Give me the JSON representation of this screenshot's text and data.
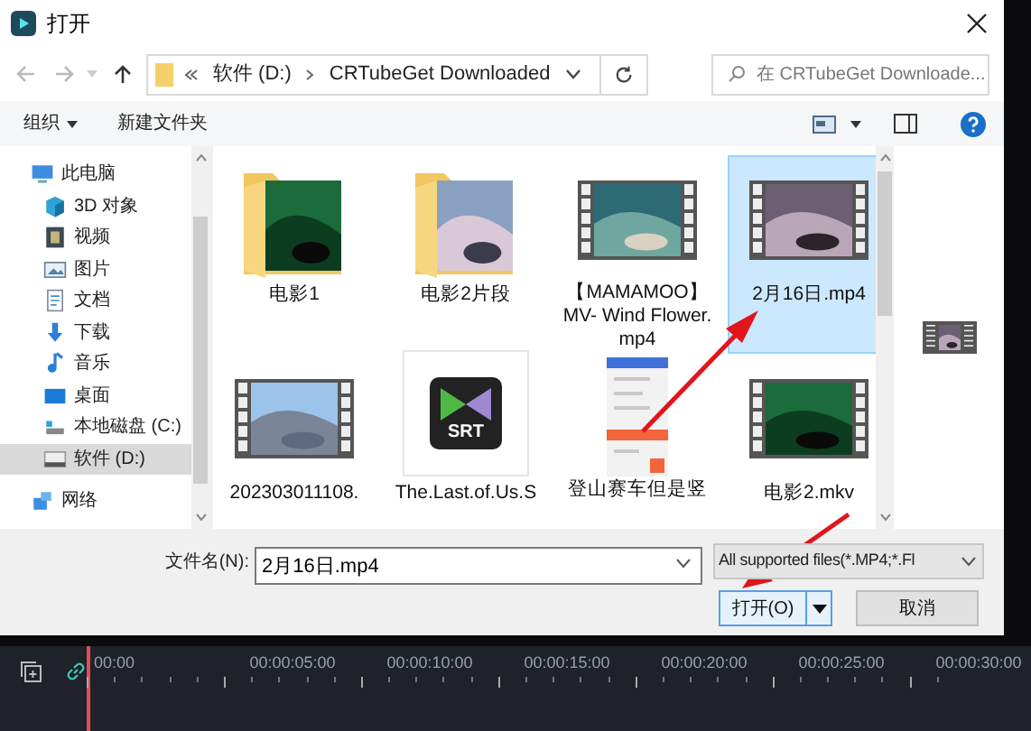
{
  "window": {
    "title": "打开"
  },
  "address": {
    "segments": [
      "软件 (D:)",
      "CRTubeGet Downloaded"
    ]
  },
  "search": {
    "placeholder": "在 CRTubeGet Downloade..."
  },
  "toolbar": {
    "organize": "组织",
    "new_folder": "新建文件夹"
  },
  "sidebar": {
    "items": [
      {
        "label": "此电脑",
        "selected": false,
        "children": [
          {
            "label": "3D 对象",
            "selected": false
          },
          {
            "label": "视频",
            "selected": false
          },
          {
            "label": "图片",
            "selected": false
          },
          {
            "label": "文档",
            "selected": false
          },
          {
            "label": "下载",
            "selected": false
          },
          {
            "label": "音乐",
            "selected": false
          },
          {
            "label": "桌面",
            "selected": false
          },
          {
            "label": "本地磁盘 (C:)",
            "selected": false
          },
          {
            "label": "软件 (D:)",
            "selected": true
          }
        ]
      },
      {
        "label": "网络",
        "selected": false
      }
    ]
  },
  "files": [
    {
      "name": "电影1",
      "kind": "folder",
      "selected": false
    },
    {
      "name": "电影2片段",
      "kind": "folder",
      "selected": false
    },
    {
      "name": "【MAMAMOO】MV- Wind Flower.mp4",
      "kind": "video",
      "selected": false
    },
    {
      "name": "2月16日.mp4",
      "kind": "video",
      "selected": true
    },
    {
      "name": "202303011108.",
      "kind": "video",
      "selected": false
    },
    {
      "name": "The.Last.of.Us.S",
      "kind": "subtitle",
      "badge": "SRT",
      "selected": false
    },
    {
      "name": "登山赛车但是竖",
      "kind": "screenshot",
      "selected": false
    },
    {
      "name": "电影2.mkv",
      "kind": "video",
      "selected": false
    }
  ],
  "filename": {
    "label": "文件名(N):",
    "value": "2月16日.mp4"
  },
  "file_type": {
    "value": "All supported files(*.MP4;*.Fl"
  },
  "buttons": [
    {
      "label": "打开(O)",
      "kind": "split"
    },
    {
      "label": "取消",
      "kind": "plain"
    }
  ],
  "timeline": {
    "ticks": [
      "00:00",
      "00:00:05:00",
      "00:00:10:00",
      "00:00:15:00",
      "00:00:20:00",
      "00:00:25:00",
      "00:00:30:00"
    ]
  }
}
